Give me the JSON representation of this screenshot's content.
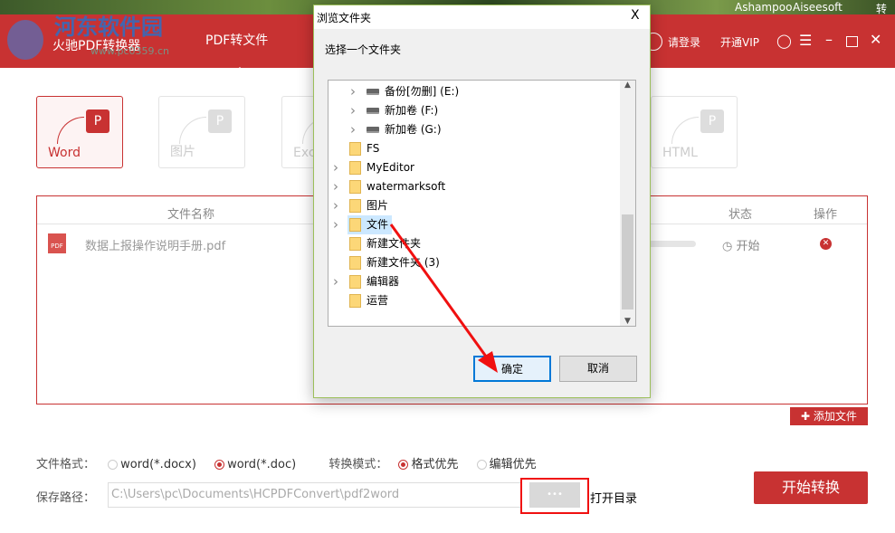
{
  "topbar": {
    "items": [
      "Ashampoo",
      "Aiseesoft",
      "转转"
    ]
  },
  "header": {
    "watermark": "河东软件园",
    "watermark_url": "www.pc0359.cn",
    "app_title": "火驰PDF转换器",
    "nav_tab": "PDF转文件",
    "login": "请登录",
    "vip": "开通VIP",
    "accent": "#c83232"
  },
  "tabs": [
    {
      "label": "Word",
      "active": true
    },
    {
      "label": "图片"
    },
    {
      "label": "Exc"
    },
    {
      "label": "HTML"
    }
  ],
  "table": {
    "headers": [
      "文件名称",
      "状态",
      "操作"
    ],
    "rows": [
      {
        "name": "数据上报操作说明手册.pdf",
        "status": "开始"
      }
    ]
  },
  "add_file": "添加文件",
  "options": {
    "format_label": "文件格式：",
    "formats": [
      {
        "label": "word(*.docx)",
        "selected": false
      },
      {
        "label": "word(*.doc)",
        "selected": true
      }
    ],
    "mode_label": "转换模式：",
    "modes": [
      {
        "label": "格式优先",
        "selected": true
      },
      {
        "label": "编辑优先",
        "selected": false
      }
    ]
  },
  "save": {
    "label": "保存路径：",
    "path": "C:\\Users\\pc\\Documents\\HCPDFConvert\\pdf2word",
    "browse": "•••",
    "open_dir": "打开目录"
  },
  "start": "开始转换",
  "dialog": {
    "title": "浏览文件夹",
    "close": "X",
    "prompt": "选择一个文件夹",
    "ok": "确定",
    "cancel": "取消",
    "tree": [
      {
        "label": "备份[勿删] (E:)",
        "type": "drive",
        "expand": true
      },
      {
        "label": "新加卷 (F:)",
        "type": "drive",
        "expand": true
      },
      {
        "label": "新加卷 (G:)",
        "type": "drive",
        "expand": true
      },
      {
        "label": "FS",
        "type": "folder",
        "expand": false
      },
      {
        "label": "MyEditor",
        "type": "folder",
        "expand": true
      },
      {
        "label": "watermarksoft",
        "type": "folder",
        "expand": true
      },
      {
        "label": "图片",
        "type": "folder",
        "expand": true
      },
      {
        "label": "文件",
        "type": "folder",
        "expand": true,
        "selected": true
      },
      {
        "label": "新建文件夹",
        "type": "folder",
        "expand": false
      },
      {
        "label": "新建文件夹 (3)",
        "type": "folder",
        "expand": false
      },
      {
        "label": "编辑器",
        "type": "folder",
        "expand": true
      },
      {
        "label": "运营",
        "type": "folder",
        "expand": false
      }
    ]
  }
}
